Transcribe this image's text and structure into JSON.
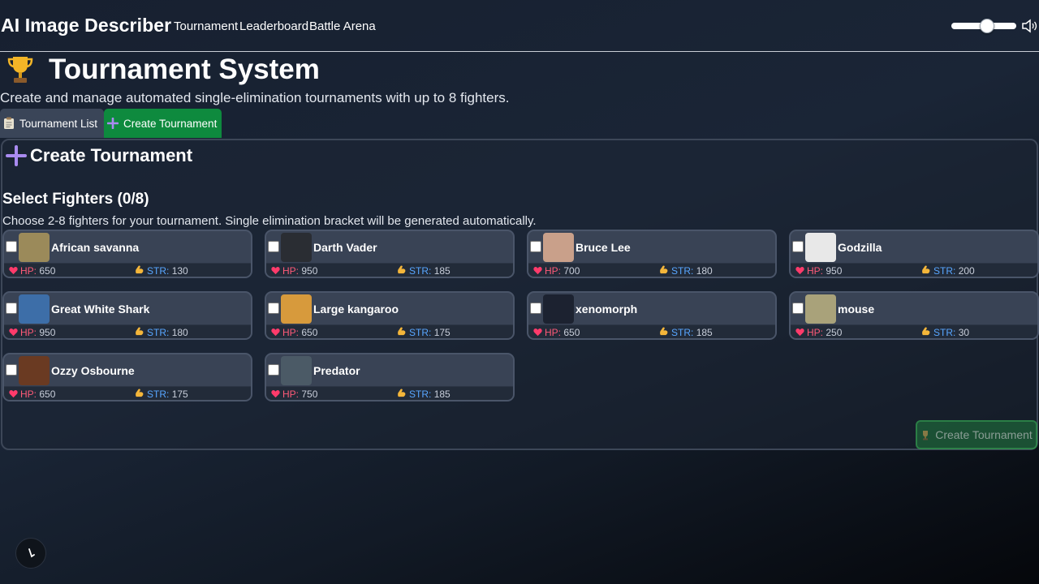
{
  "app": {
    "title": "AI Image Describer"
  },
  "nav": [
    {
      "label": "Tournament"
    },
    {
      "label": "Leaderboard"
    },
    {
      "label": "Battle Arena"
    }
  ],
  "volume": {
    "level": 0.5,
    "icon": "speaker-icon"
  },
  "page": {
    "title": "Tournament System",
    "title_icon": "trophy-icon",
    "subtitle": "Create and manage automated single-elimination tournaments with up to 8 fighters."
  },
  "tabs": [
    {
      "label": "Tournament List",
      "icon": "clipboard-icon",
      "active": false
    },
    {
      "label": "Create Tournament",
      "icon": "plus-icon",
      "active": true
    }
  ],
  "create_panel": {
    "heading": "Create Tournament",
    "select_title": "Select Fighters (0/8)",
    "select_desc": "Choose 2-8 fighters for your tournament. Single elimination bracket will be generated automatically.",
    "hp_label": "HP:",
    "str_label": "STR:",
    "submit_label": "Create Tournament"
  },
  "fighters": [
    {
      "name": "African savanna",
      "hp": "650",
      "str": "130",
      "checked": false,
      "color": "#9b8a5a"
    },
    {
      "name": "Darth Vader",
      "hp": "950",
      "str": "185",
      "checked": false,
      "color": "#2a2d33"
    },
    {
      "name": "Bruce Lee",
      "hp": "700",
      "str": "180",
      "checked": false,
      "color": "#c9a08a"
    },
    {
      "name": "Godzilla",
      "hp": "950",
      "str": "200",
      "checked": false,
      "color": "#e8e8e8"
    },
    {
      "name": "Great White Shark",
      "hp": "950",
      "str": "180",
      "checked": false,
      "color": "#3d6ea8"
    },
    {
      "name": "Large kangaroo",
      "hp": "650",
      "str": "175",
      "checked": false,
      "color": "#d79a3c"
    },
    {
      "name": "xenomorph",
      "hp": "650",
      "str": "185",
      "checked": false,
      "color": "#1c2230"
    },
    {
      "name": "mouse",
      "hp": "250",
      "str": "30",
      "checked": false,
      "color": "#a9a27a"
    },
    {
      "name": "Ozzy Osbourne",
      "hp": "650",
      "str": "175",
      "checked": false,
      "color": "#6a3a22"
    },
    {
      "name": "Predator",
      "hp": "750",
      "str": "185",
      "checked": false,
      "color": "#4b5a66"
    }
  ]
}
